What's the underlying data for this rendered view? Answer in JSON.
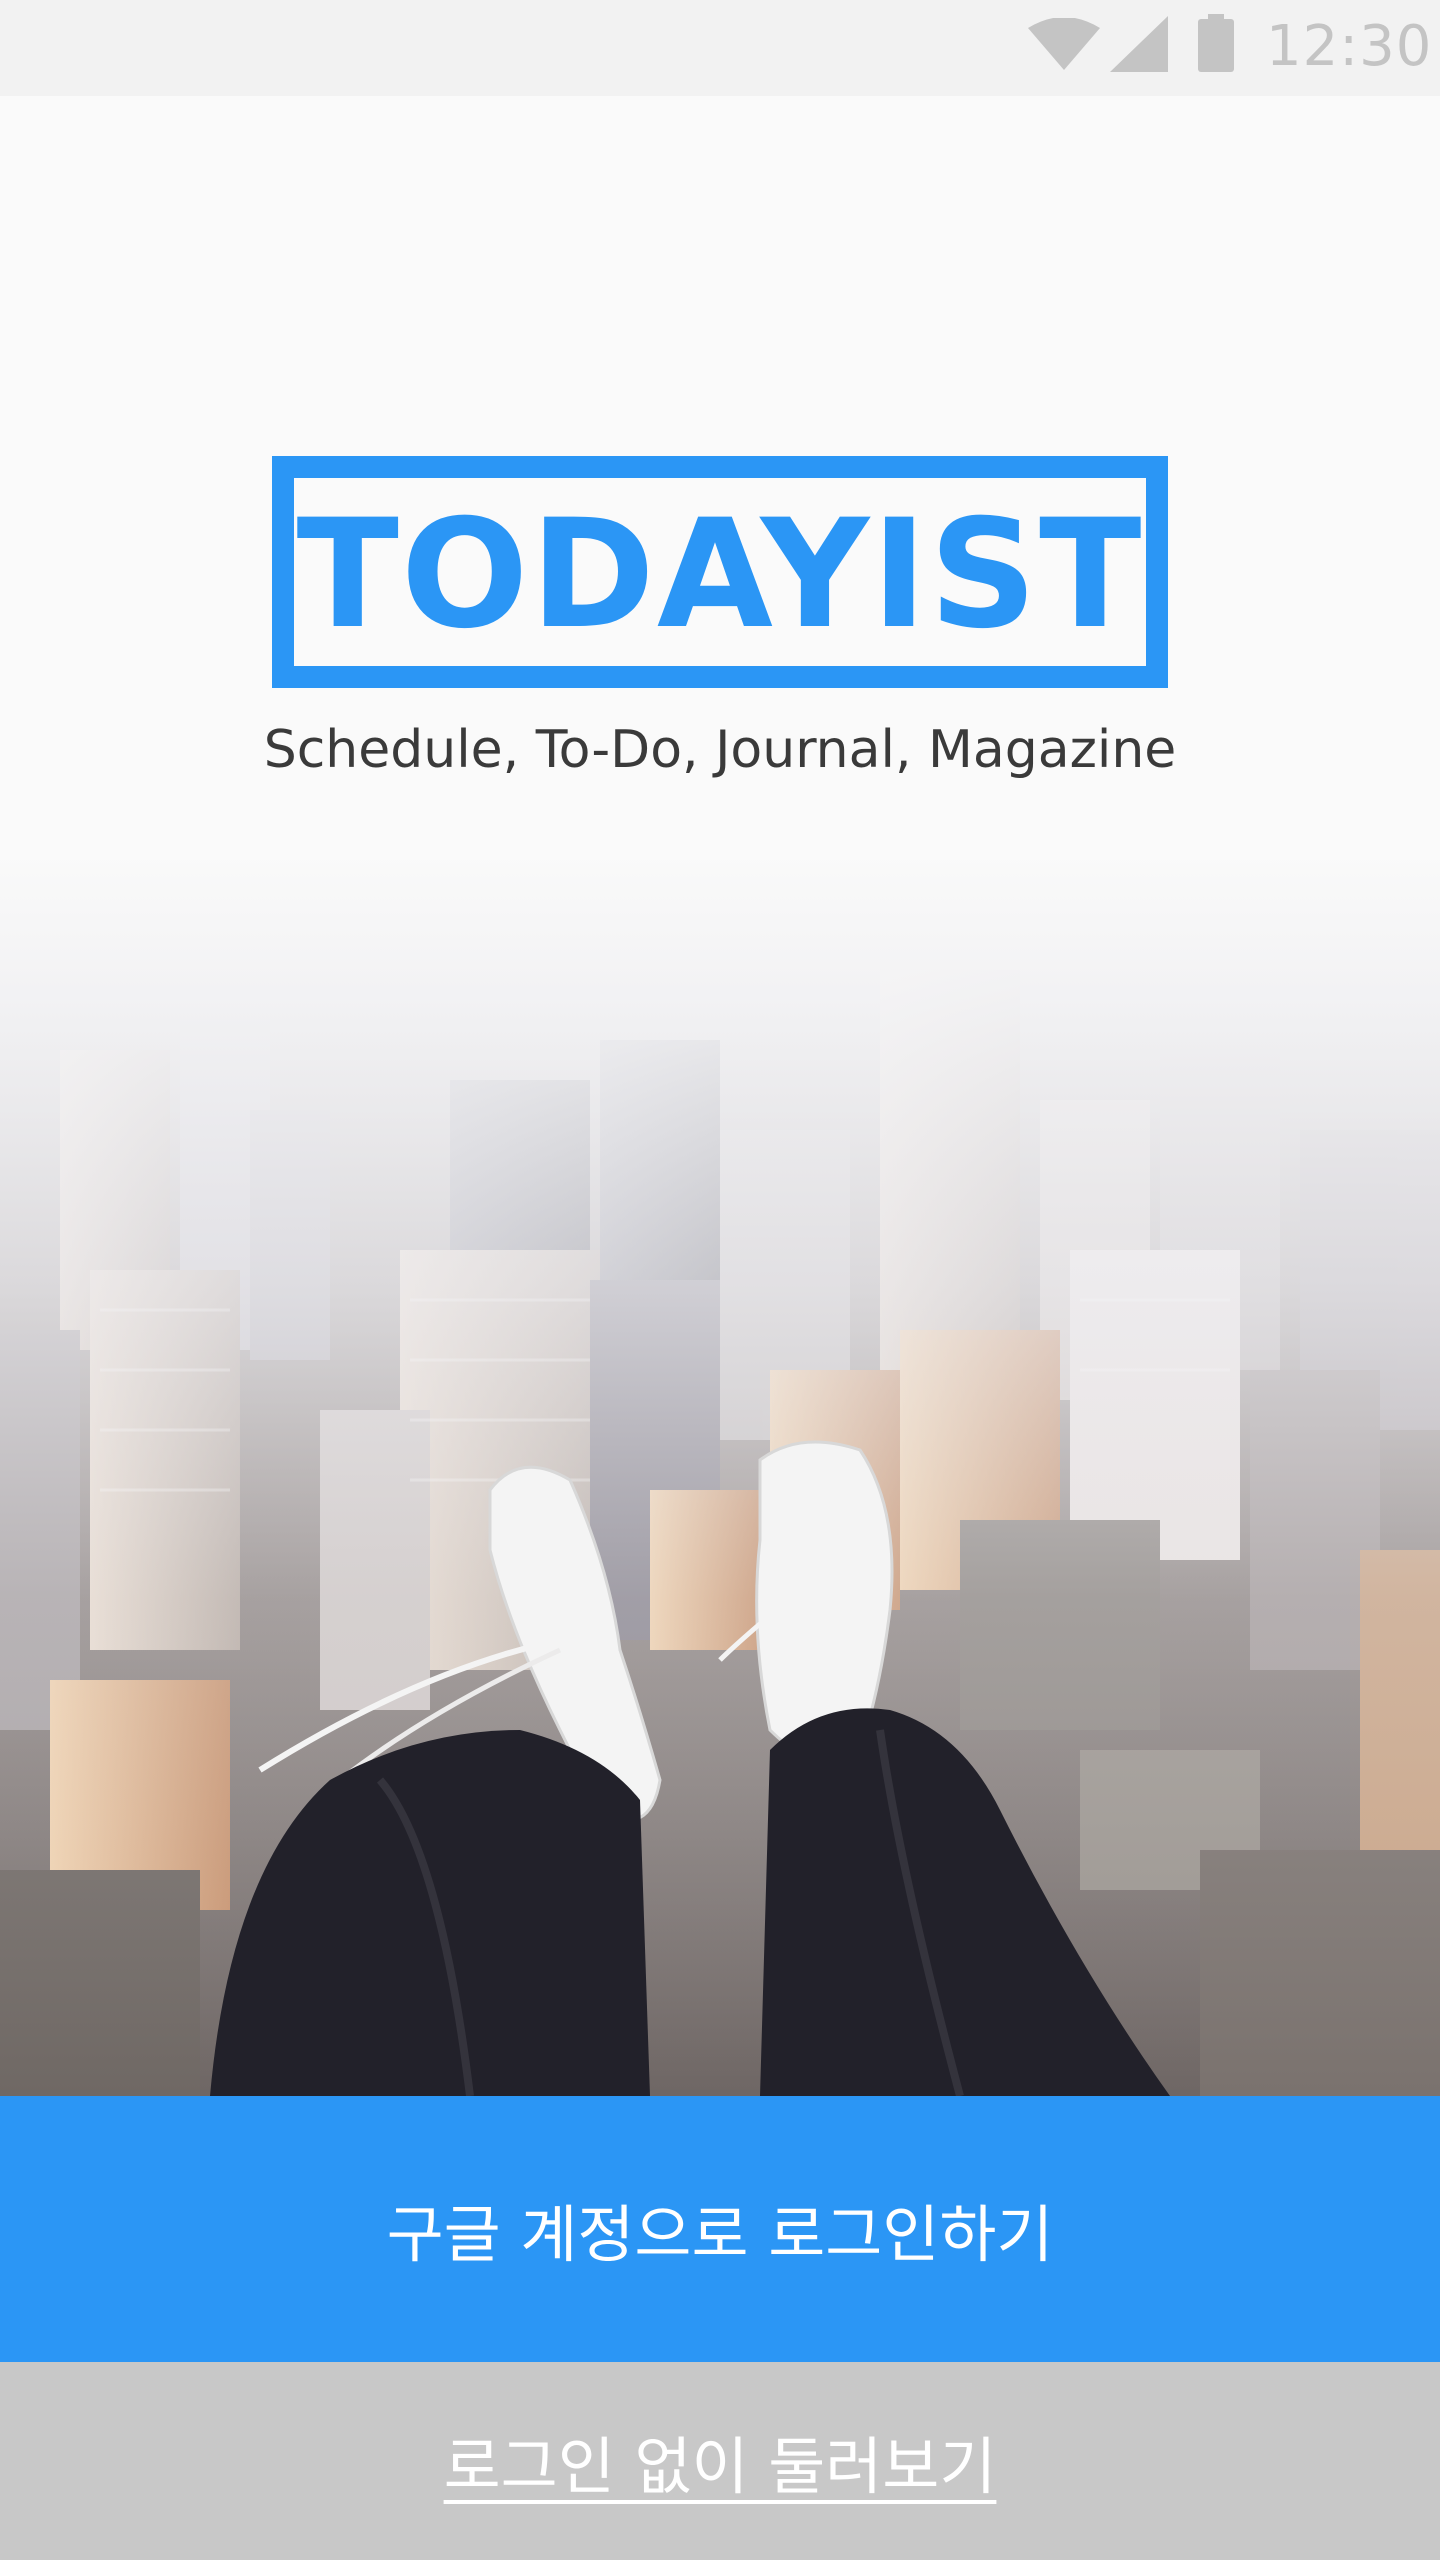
{
  "status_bar": {
    "time": "12:30",
    "icons": [
      "wifi-icon",
      "signal-icon",
      "battery-icon"
    ],
    "text_color": "#c4c4c4"
  },
  "brand": {
    "logo_text": "TODAYIST",
    "tagline": "Schedule, To-Do, Journal, Magazine",
    "accent_color": "#2b96f5"
  },
  "hero": {
    "description_icon": "city-skyline-feet-photo"
  },
  "actions": {
    "google_login_label": "구글 계정으로 로그인하기",
    "browse_without_login_label": "로그인 없이 둘러보기"
  },
  "colors": {
    "primary_button": "#2b96f5",
    "secondary_button": "#c8c8c8"
  }
}
